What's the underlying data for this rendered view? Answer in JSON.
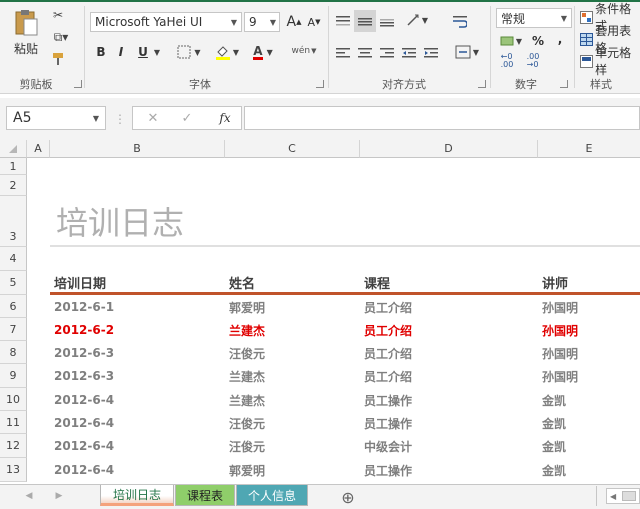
{
  "ribbon": {
    "clipboard": {
      "paste_label": "粘贴",
      "group_label": "剪贴板"
    },
    "font": {
      "font_name": "Microsoft YaHei UI",
      "font_size": "9",
      "grow_label": "A",
      "shrink_label": "A",
      "bold": "B",
      "italic": "I",
      "underline": "U",
      "font_color_label": "A",
      "phonetic_label": "wén",
      "group_label": "字体"
    },
    "alignment": {
      "group_label": "对齐方式"
    },
    "number": {
      "format": "常规",
      "percent": "%",
      "comma": ",",
      "group_label": "数字"
    },
    "styles": {
      "conditional": "条件格式",
      "table": "套用表格",
      "cell": "单元格样",
      "group_label": "样式"
    }
  },
  "formula_bar": {
    "name_box": "A5",
    "cancel": "✕",
    "enter": "✓",
    "fx": "fx",
    "value": ""
  },
  "columns": [
    "A",
    "B",
    "C",
    "D",
    "E"
  ],
  "rows": [
    "1",
    "2",
    "3",
    "4",
    "5",
    "6",
    "7",
    "8",
    "9",
    "10",
    "11",
    "12",
    "13"
  ],
  "sheet": {
    "title": "培训日志",
    "headers": [
      "培训日期",
      "姓名",
      "课程",
      "讲师"
    ],
    "data": [
      {
        "date": "2012-6-1",
        "name": "郭爱明",
        "course": "员工介绍",
        "teacher": "孙国明"
      },
      {
        "date": "2012-6-2",
        "name": "兰建杰",
        "course": "员工介绍",
        "teacher": "孙国明"
      },
      {
        "date": "2012-6-3",
        "name": "汪俊元",
        "course": "员工介绍",
        "teacher": "孙国明"
      },
      {
        "date": "2012-6-3",
        "name": "兰建杰",
        "course": "员工介绍",
        "teacher": "孙国明"
      },
      {
        "date": "2012-6-4",
        "name": "兰建杰",
        "course": "员工操作",
        "teacher": "金凯"
      },
      {
        "date": "2012-6-4",
        "name": "汪俊元",
        "course": "员工操作",
        "teacher": "金凯"
      },
      {
        "date": "2012-6-4",
        "name": "汪俊元",
        "course": "中级会计",
        "teacher": "金凯"
      },
      {
        "date": "2012-6-4",
        "name": "郭爱明",
        "course": "员工操作",
        "teacher": "金凯"
      }
    ],
    "highlight_color": "#e00000",
    "rule_color": "#c0532a"
  },
  "tabs": {
    "items": [
      {
        "label": "培训日志",
        "color": "#f4d7c8"
      },
      {
        "label": "课程表",
        "color": "#8fce6a"
      },
      {
        "label": "个人信息",
        "color": "#4fa7b3"
      }
    ],
    "add_label": "⊕"
  }
}
